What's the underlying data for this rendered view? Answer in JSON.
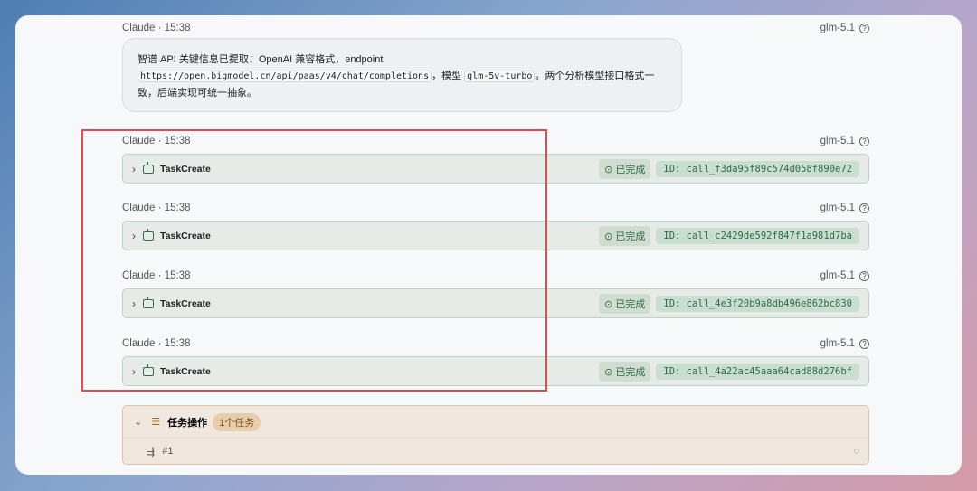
{
  "messages": [
    {
      "author": "Claude",
      "time": "15:38",
      "model": "glm-5.1",
      "text_parts": [
        "智谱 API 关键信息已提取：OpenAI 兼容格式，endpoint ",
        "https://open.bigmodel.cn/api/paas/v4/chat/completions",
        "，模型 ",
        "glm-5v-turbo",
        "。两个分析模型接口格式一致，后端实现可统一抽象。"
      ]
    }
  ],
  "tool_calls": [
    {
      "author": "Claude",
      "time": "15:38",
      "model": "glm-5.1",
      "name": "TaskCreate",
      "status": "已完成",
      "id": "ID: call_f3da95f89c574d058f890e72"
    },
    {
      "author": "Claude",
      "time": "15:38",
      "model": "glm-5.1",
      "name": "TaskCreate",
      "status": "已完成",
      "id": "ID: call_c2429de592f847f1a981d7ba"
    },
    {
      "author": "Claude",
      "time": "15:38",
      "model": "glm-5.1",
      "name": "TaskCreate",
      "status": "已完成",
      "id": "ID: call_4e3f20b9a8db496e862bc830"
    },
    {
      "author": "Claude",
      "time": "15:38",
      "model": "glm-5.1",
      "name": "TaskCreate",
      "status": "已完成",
      "id": "ID: call_4a22ac45aaa64cad88d276bf"
    }
  ],
  "task_panel": {
    "title": "任务操作",
    "badge": "1个任务",
    "items": [
      {
        "label": "#1"
      }
    ]
  },
  "separator": "·"
}
